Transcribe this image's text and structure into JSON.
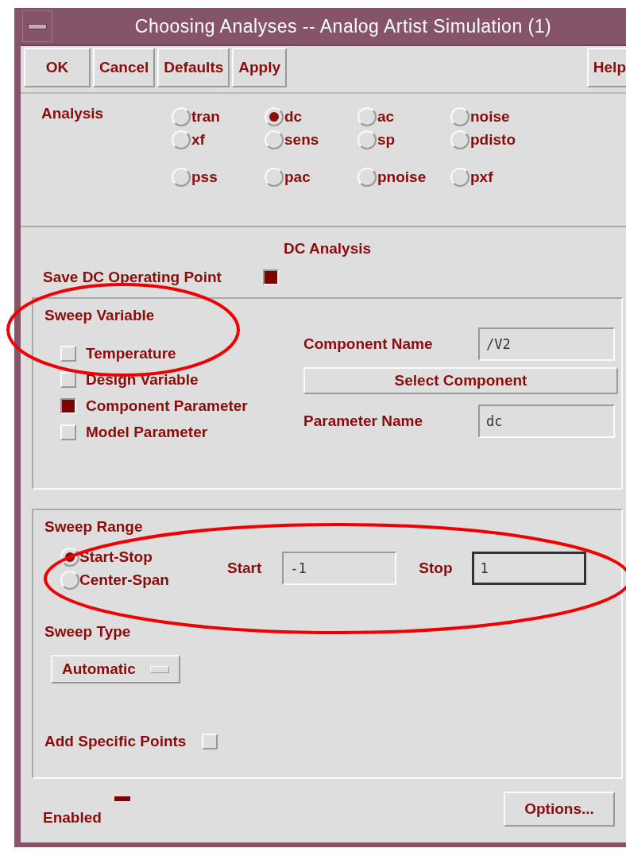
{
  "window": {
    "title": "Choosing Analyses -- Analog Artist Simulation (1)"
  },
  "toolbar": {
    "buttons": [
      "OK",
      "Cancel",
      "Defaults",
      "Apply"
    ],
    "help": "Help"
  },
  "analysis": {
    "label": "Analysis",
    "rows": [
      [
        {
          "label": "tran",
          "selected": false
        },
        {
          "label": "dc",
          "selected": true
        },
        {
          "label": "ac",
          "selected": false
        },
        {
          "label": "noise",
          "selected": false
        }
      ],
      [
        {
          "label": "xf",
          "selected": false
        },
        {
          "label": "sens",
          "selected": false
        },
        {
          "label": "sp",
          "selected": false
        },
        {
          "label": "pdisto",
          "selected": false
        }
      ],
      [
        {
          "label": "pss",
          "selected": false
        },
        {
          "label": "pac",
          "selected": false
        },
        {
          "label": "pnoise",
          "selected": false
        },
        {
          "label": "pxf",
          "selected": false
        }
      ]
    ]
  },
  "dc_analysis": {
    "title": "DC Analysis",
    "save_op": {
      "label": "Save DC Operating Point",
      "checked": true
    }
  },
  "sweep_variable": {
    "title": "Sweep Variable",
    "options": [
      {
        "label": "Temperature",
        "checked": false
      },
      {
        "label": "Design Variable",
        "checked": false
      },
      {
        "label": "Component Parameter",
        "checked": true
      },
      {
        "label": "Model Parameter",
        "checked": false
      }
    ],
    "component_name": {
      "label": "Component Name",
      "value": "/V2"
    },
    "select_button": "Select Component",
    "parameter_name": {
      "label": "Parameter Name",
      "value": "dc"
    }
  },
  "sweep_range": {
    "title": "Sweep Range",
    "modes": [
      {
        "label": "Start-Stop",
        "selected": true
      },
      {
        "label": "Center-Span",
        "selected": false
      }
    ],
    "start": {
      "label": "Start",
      "value": "-1",
      "focused": false
    },
    "stop": {
      "label": "Stop",
      "value": "1",
      "focused": true
    }
  },
  "sweep_type": {
    "title": "Sweep Type",
    "value": "Automatic"
  },
  "add_points": {
    "label": "Add Specific Points",
    "checked": false
  },
  "enabled": {
    "label": "Enabled",
    "on": true
  },
  "options_button": "Options..."
}
